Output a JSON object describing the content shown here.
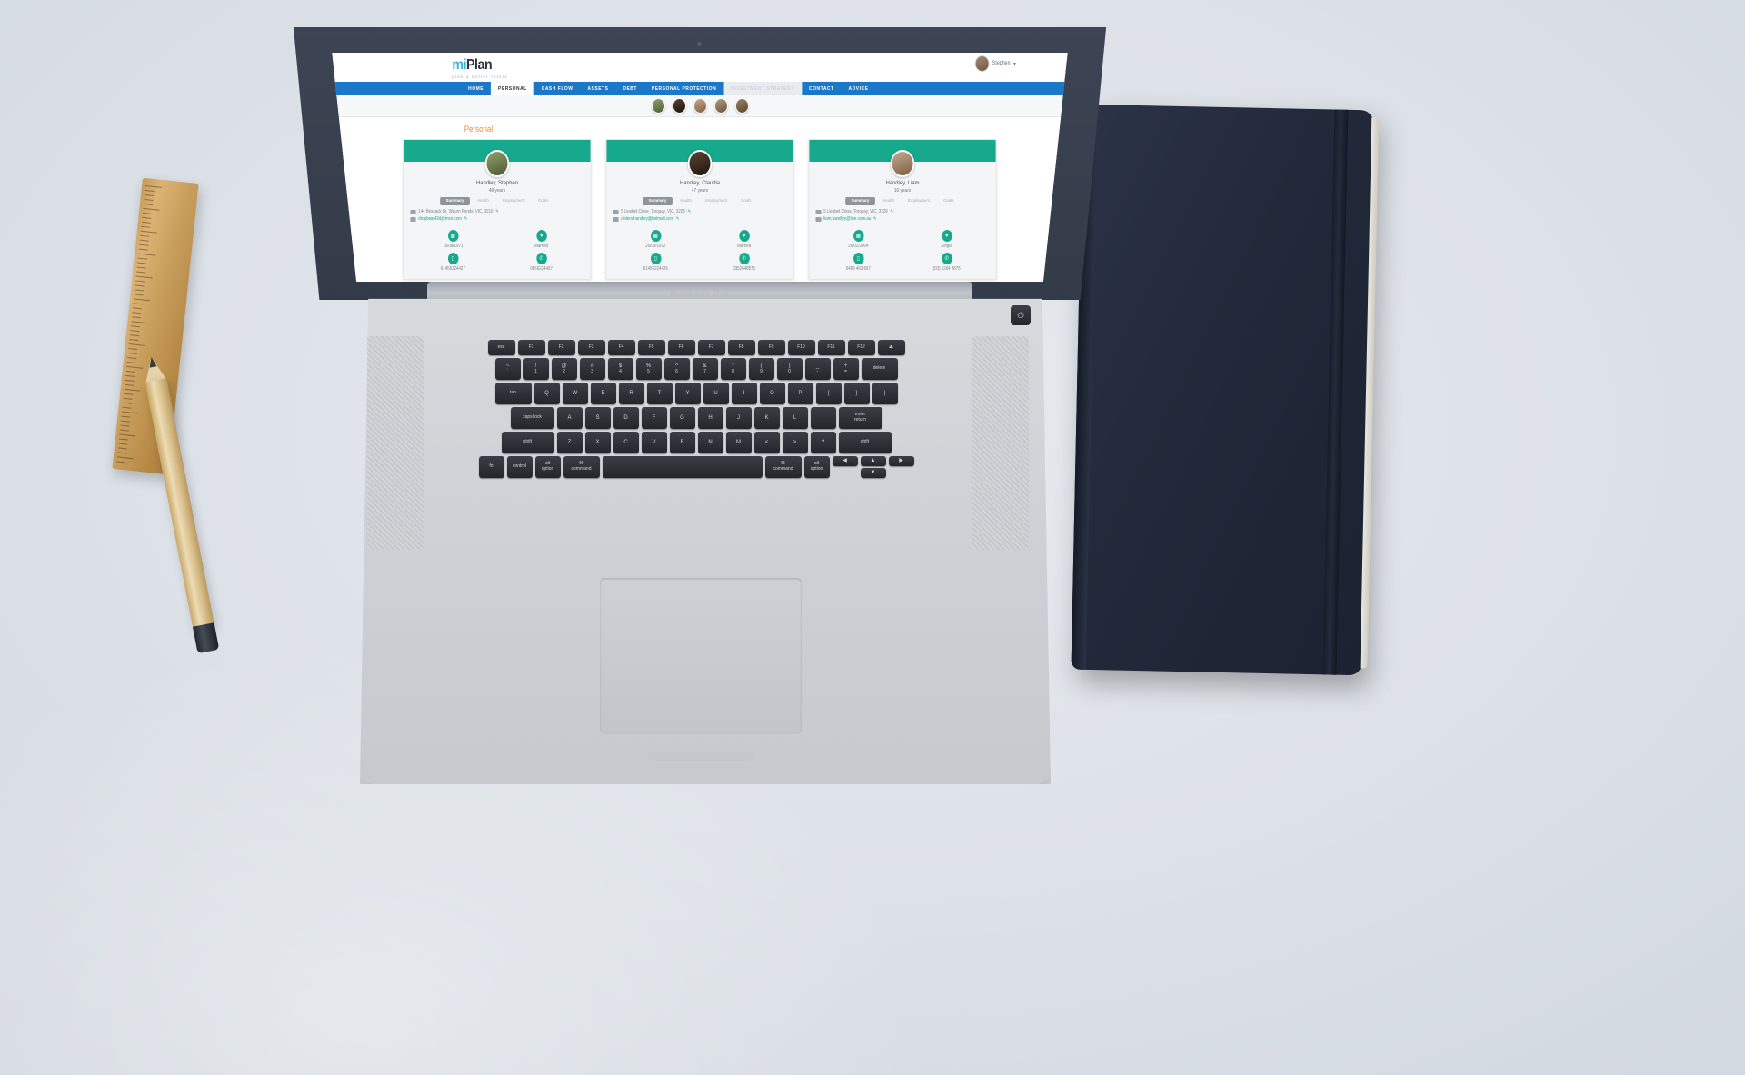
{
  "scene": {
    "device": "MacBook Pro",
    "desk_objects": [
      "wooden-ruler",
      "pencil",
      "notebook"
    ]
  },
  "app": {
    "logo": {
      "brand_mi": "mi",
      "brand_plan": "Plan",
      "tagline": "plan a better future"
    },
    "user": {
      "name": "Stephen",
      "caret": "▾"
    },
    "nav": [
      {
        "label": "HOME",
        "state": "default"
      },
      {
        "label": "PERSONAL",
        "state": "active"
      },
      {
        "label": "CASH FLOW",
        "state": "default"
      },
      {
        "label": "ASSETS",
        "state": "default"
      },
      {
        "label": "DEBT",
        "state": "default"
      },
      {
        "label": "PERSONAL PROTECTION",
        "state": "default"
      },
      {
        "label": "INVESTMENT STRATEGY",
        "state": "muted"
      },
      {
        "label": "CONTACT",
        "state": "default"
      },
      {
        "label": "ADVICE",
        "state": "default"
      }
    ],
    "people_strip": [
      "avatar-1",
      "avatar-2",
      "avatar-3",
      "avatar-4",
      "avatar-5"
    ],
    "page_title": "Personal",
    "tabs": [
      "Summary",
      "Health",
      "Employment",
      "Goals"
    ],
    "colors": {
      "nav_blue": "#1b77c8",
      "accent_green": "#16a98b",
      "title_orange": "#f08c36"
    },
    "cards": [
      {
        "name": "Handley, Stephen",
        "age": "48 years",
        "active_tab": "Summary",
        "address": "144 Bossack Dr, Waurn Ponds, VIC, 3216",
        "email": "dropbear42d@msn.com",
        "fields": [
          {
            "icon": "cake-icon",
            "value": "16/08/1971"
          },
          {
            "icon": "heart-icon",
            "value": "Married"
          },
          {
            "icon": "mobile-icon",
            "value": "61456224427"
          },
          {
            "icon": "phone-icon",
            "value": "0456224427"
          }
        ]
      },
      {
        "name": "Handley, Claudia",
        "age": "47 years",
        "active_tab": "Summary",
        "address": "5 Liesbet Close, Torquay, VIC, 3228",
        "email": "clolenahandley@hotmail.com",
        "fields": [
          {
            "icon": "cake-icon",
            "value": "20/09/1972"
          },
          {
            "icon": "heart-icon",
            "value": "Married"
          },
          {
            "icon": "mobile-icon",
            "value": "61456224426"
          },
          {
            "icon": "phone-icon",
            "value": "0352648875"
          }
        ]
      },
      {
        "name": "Handley, Liam",
        "age": "16 years",
        "active_tab": "Summary",
        "address": "5 Liesbet Close, Torquay, VIC, 3228",
        "email": "liam.handley@iine.com.au",
        "fields": [
          {
            "icon": "cake-icon",
            "value": "26/02/2004"
          },
          {
            "icon": "heart-icon",
            "value": "Single"
          },
          {
            "icon": "mobile-icon",
            "value": "0403 463 667"
          },
          {
            "icon": "phone-icon",
            "value": "(03) 5264 8875"
          }
        ]
      }
    ]
  },
  "keyboard": {
    "fn_row": [
      "esc",
      "F1",
      "F2",
      "F3",
      "F4",
      "F5",
      "F6",
      "F7",
      "F8",
      "F9",
      "F10",
      "F11",
      "F12",
      "⏏"
    ],
    "row1": [
      "~",
      "!",
      "@",
      "#",
      "$",
      "%",
      "^",
      "&",
      "*",
      "(",
      ")",
      "_",
      "+",
      "delete"
    ],
    "row1b": [
      "`",
      "1",
      "2",
      "3",
      "4",
      "5",
      "6",
      "7",
      "8",
      "9",
      "0",
      "-",
      "="
    ],
    "row2": [
      "tab",
      "Q",
      "W",
      "E",
      "R",
      "T",
      "Y",
      "U",
      "I",
      "O",
      "P",
      "{",
      "}",
      "|"
    ],
    "row3": [
      "caps lock",
      "A",
      "S",
      "D",
      "F",
      "G",
      "H",
      "J",
      "K",
      "L",
      ":",
      ";",
      "enter"
    ],
    "row3b": [
      "return"
    ],
    "row4": [
      "shift",
      "Z",
      "X",
      "C",
      "V",
      "B",
      "N",
      "M",
      "<",
      ">",
      "?",
      "shift"
    ],
    "row5": [
      "fn",
      "control",
      "option",
      "command",
      "",
      "command",
      "option"
    ],
    "modifier_alt": "alt",
    "modifier_cmd": "⌘"
  }
}
